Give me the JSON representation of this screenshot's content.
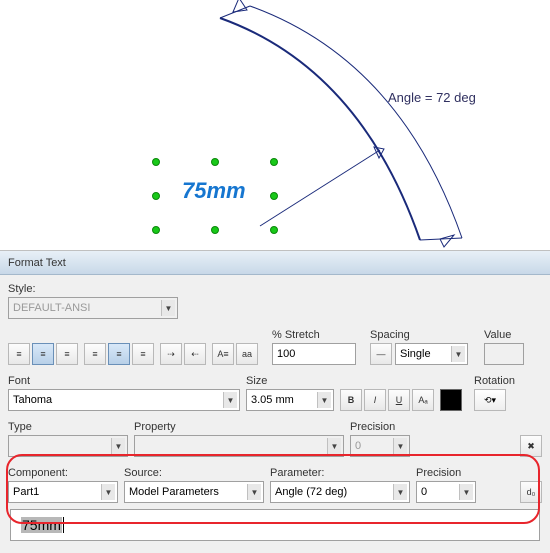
{
  "canvas": {
    "dimension_text": "75mm",
    "angle_annotation": "Angle = 72 deg"
  },
  "dialog": {
    "title": "Format Text",
    "style_label": "Style:",
    "style_value": "DEFAULT-ANSI",
    "stretch_label": "% Stretch",
    "stretch_value": "100",
    "spacing_label": "Spacing",
    "spacing_value": "Single",
    "value_label": "Value",
    "font_label": "Font",
    "font_value": "Tahoma",
    "size_label": "Size",
    "size_value": "3.05 mm",
    "rotation_label": "Rotation",
    "type_label": "Type",
    "property_label": "Property",
    "precision1_label": "Precision",
    "precision1_value": "0",
    "component_label": "Component:",
    "component_value": "Part1",
    "source_label": "Source:",
    "source_value": "Model Parameters",
    "parameter_label": "Parameter:",
    "parameter_value": "Angle (72 deg)",
    "precision2_label": "Precision",
    "precision2_value": "0",
    "edit_text": "75mm"
  }
}
